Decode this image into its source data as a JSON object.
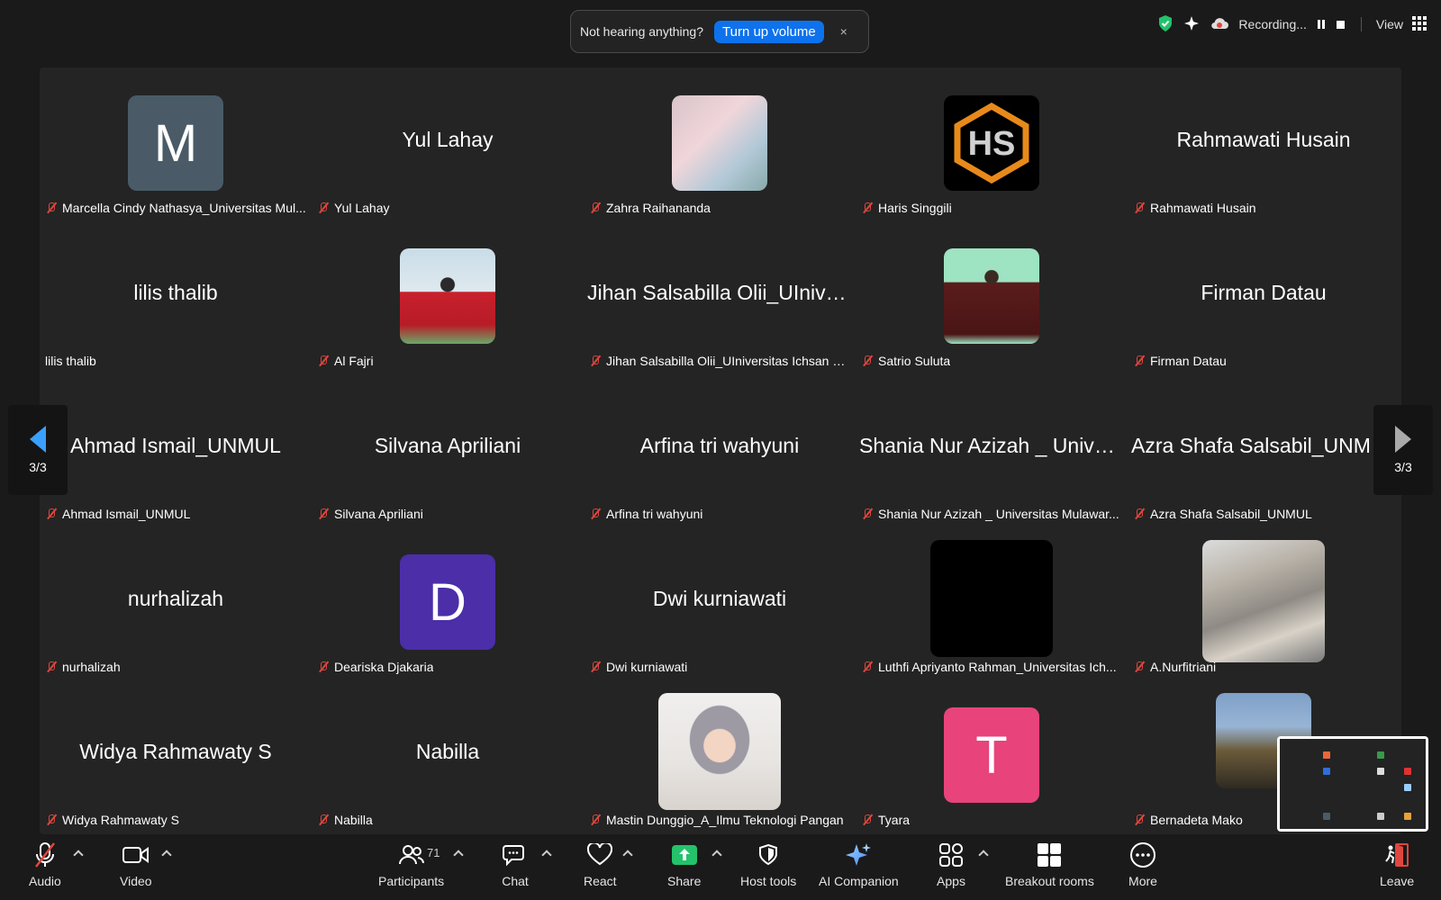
{
  "notice": {
    "message": "Not hearing anything?",
    "action": "Turn up volume",
    "close": "×"
  },
  "status": {
    "recording": "Recording...",
    "view": "View"
  },
  "pager": {
    "left": "3/3",
    "right": "3/3"
  },
  "tiles": [
    {
      "label": "Marcella Cindy Nathasya_Universitas Mul...",
      "muted": true,
      "kind": "avatar",
      "letter": "M",
      "color": "#4a5b67"
    },
    {
      "label": "Yul Lahay",
      "muted": true,
      "kind": "name",
      "center": "Yul Lahay"
    },
    {
      "label": "Zahra Raihananda",
      "muted": true,
      "kind": "photo"
    },
    {
      "label": "Haris Singgili",
      "muted": true,
      "kind": "logo"
    },
    {
      "label": "Rahmawati Husain",
      "muted": true,
      "kind": "name",
      "center": "Rahmawati Husain"
    },
    {
      "label": "lilis thalib",
      "muted": false,
      "kind": "name",
      "center": "lilis thalib"
    },
    {
      "label": "Al Fajri",
      "muted": true,
      "kind": "photo"
    },
    {
      "label": "Jihan Salsabilla Olii_UIniversitas Ichsan G...",
      "muted": true,
      "kind": "name",
      "center": "Jihan Salsabilla Olii_UIniversitas Ichsan G..."
    },
    {
      "label": "Satrio Suluta",
      "muted": true,
      "kind": "photo"
    },
    {
      "label": "Firman Datau",
      "muted": true,
      "kind": "name",
      "center": "Firman Datau"
    },
    {
      "label": "Ahmad Ismail_UNMUL",
      "muted": true,
      "kind": "name",
      "center": "Ahmad Ismail_UNMUL"
    },
    {
      "label": "Silvana Apriliani",
      "muted": true,
      "kind": "name",
      "center": "Silvana Apriliani"
    },
    {
      "label": "Arfina tri wahyuni",
      "muted": true,
      "kind": "name",
      "center": "Arfina tri wahyuni"
    },
    {
      "label": "Shania Nur Azizah _ Universitas Mulawar...",
      "muted": true,
      "kind": "name",
      "center": "Shania Nur Azizah _ Universitas Mulawar..."
    },
    {
      "label": "Azra Shafa Salsabil_UNMUL",
      "muted": true,
      "kind": "name",
      "center": "Azra Shafa Salsabil_UNMUL"
    },
    {
      "label": "nurhalizah",
      "muted": true,
      "kind": "name",
      "center": "nurhalizah"
    },
    {
      "label": "Deariska Djakaria",
      "muted": true,
      "kind": "avatar",
      "letter": "D",
      "color": "#4b2ea8"
    },
    {
      "label": "Dwi kurniawati",
      "muted": true,
      "kind": "name",
      "center": "Dwi kurniawati"
    },
    {
      "label": "Luthfi Apriyanto Rahman_Universitas Ich...",
      "muted": true,
      "kind": "video-black"
    },
    {
      "label": "A.Nurfitriani",
      "muted": true,
      "kind": "video"
    },
    {
      "label": "Widya Rahmawaty S",
      "muted": true,
      "kind": "name",
      "center": "Widya Rahmawaty S"
    },
    {
      "label": "Nabilla",
      "muted": true,
      "kind": "name",
      "center": "Nabilla"
    },
    {
      "label": "Mastin Dunggio_A_Ilmu Teknologi Pangan",
      "muted": true,
      "kind": "video"
    },
    {
      "label": "Tyara",
      "muted": true,
      "kind": "avatar",
      "letter": "T",
      "color": "#e8437a"
    },
    {
      "label": "Bernadeta Mako",
      "muted": true,
      "kind": "photo"
    }
  ],
  "toolbar": {
    "audio": "Audio",
    "video": "Video",
    "participants": "Participants",
    "participants_count": "71",
    "chat": "Chat",
    "react": "React",
    "share": "Share",
    "host_tools": "Host tools",
    "ai_companion": "AI Companion",
    "apps": "Apps",
    "breakout_rooms": "Breakout rooms",
    "more": "More",
    "leave": "Leave"
  }
}
